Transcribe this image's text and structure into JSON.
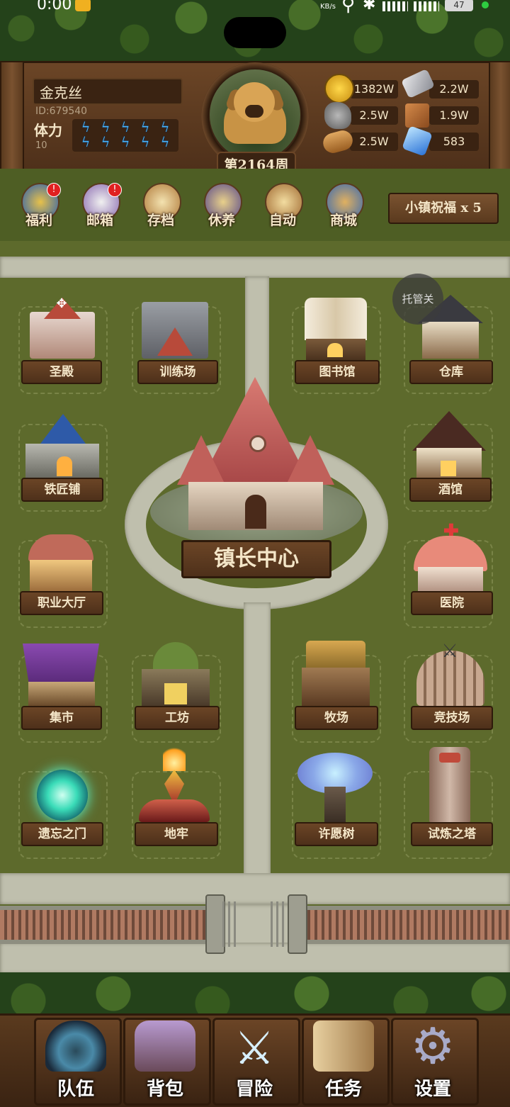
{
  "status_bar": {
    "time": "0:00",
    "net_speed": "KB/s",
    "battery": "47"
  },
  "player": {
    "name": "金克丝",
    "id": "ID:679540",
    "stamina_label": "体力",
    "stamina_value": "10",
    "week": "第2164周"
  },
  "resources": [
    {
      "icon": "gold-coin-icon",
      "value": "1382W"
    },
    {
      "icon": "iron-ingot-icon",
      "value": "2.2W"
    },
    {
      "icon": "stone-ore-icon",
      "value": "2.5W"
    },
    {
      "icon": "leather-icon",
      "value": "1.9W"
    },
    {
      "icon": "wood-log-icon",
      "value": "2.5W"
    },
    {
      "icon": "blue-crystal-icon",
      "value": "583"
    }
  ],
  "menu": [
    {
      "label": "福利",
      "badge": "!"
    },
    {
      "label": "邮箱",
      "badge": "!"
    },
    {
      "label": "存档"
    },
    {
      "label": "休养"
    },
    {
      "label": "自动"
    },
    {
      "label": "商城"
    }
  ],
  "blessing": "小镇祝福 x 5",
  "auto_toggle": "托管关",
  "buildings": {
    "temple": "圣殿",
    "training": "训练场",
    "library": "图书馆",
    "warehouse": "仓库",
    "blacksmith": "铁匠铺",
    "tavern": "酒馆",
    "town_hall": "镇长中心",
    "job_hall": "职业大厅",
    "hospital": "医院",
    "market": "集市",
    "workshop": "工坊",
    "ranch": "牧场",
    "arena": "竞技场",
    "portal": "遗忘之门",
    "dungeon": "地牢",
    "wish_tree": "许愿树",
    "trial_tower": "试炼之塔"
  },
  "nav": [
    {
      "label": "队伍",
      "icon": "helmet-icon"
    },
    {
      "label": "背包",
      "icon": "backpack-icon"
    },
    {
      "label": "冒险",
      "icon": "crossed-swords-icon"
    },
    {
      "label": "任务",
      "icon": "scroll-icon"
    },
    {
      "label": "设置",
      "icon": "gear-icon"
    }
  ],
  "colors": {
    "wood": "#6b4526",
    "plate_text": "#f4e6c8",
    "grass": "#5d6a2c",
    "road": "#bfbfad",
    "stamina": "#46b6ff"
  }
}
